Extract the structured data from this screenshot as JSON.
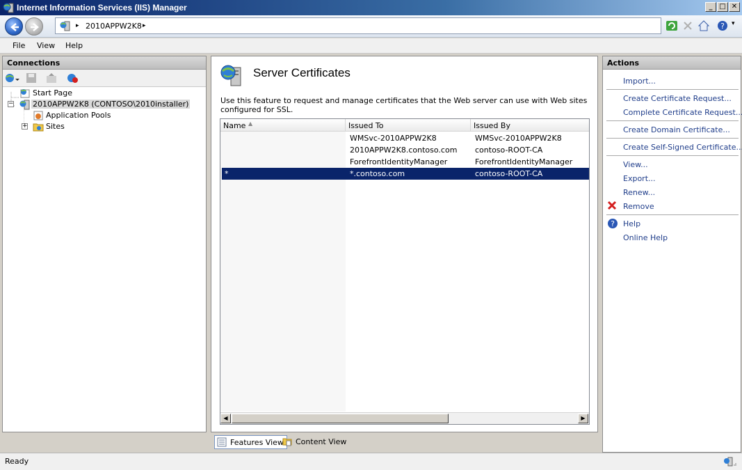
{
  "window": {
    "title": "Internet Information Services (IIS) Manager"
  },
  "address": {
    "crumb": "2010APPW2K8",
    "sep": "▸"
  },
  "menu": {
    "items": [
      "File",
      "View",
      "Help"
    ]
  },
  "connections": {
    "header": "Connections",
    "tree": {
      "start_page": "Start Page",
      "server": "2010APPW2K8 (CONTOSO\\2010installer)",
      "app_pools": "Application Pools",
      "sites": "Sites"
    }
  },
  "center": {
    "title": "Server Certificates",
    "description": "Use this feature to request and manage certificates that the Web server can use with Web sites configured for SSL.",
    "columns": {
      "name": "Name",
      "issued_to": "Issued To",
      "issued_by": "Issued By"
    },
    "rows": [
      {
        "name": "",
        "issued_to": "WMSvc-2010APPW2K8",
        "issued_by": "WMSvc-2010APPW2K8"
      },
      {
        "name": "",
        "issued_to": "2010APPW2K8.contoso.com",
        "issued_by": "contoso-ROOT-CA"
      },
      {
        "name": "",
        "issued_to": "ForefrontIdentityManager",
        "issued_by": "ForefrontIdentityManager"
      },
      {
        "name": "*",
        "issued_to": "*.contoso.com",
        "issued_by": "contoso-ROOT-CA"
      }
    ],
    "selected_row": 3,
    "views": {
      "features": "Features View",
      "content": "Content View"
    }
  },
  "actions": {
    "header": "Actions",
    "import": "Import...",
    "create_request": "Create Certificate Request...",
    "complete_request": "Complete Certificate Request...",
    "create_domain": "Create Domain Certificate...",
    "create_self_signed": "Create Self-Signed Certificate...",
    "view": "View...",
    "export": "Export...",
    "renew": "Renew...",
    "remove": "Remove",
    "help": "Help",
    "online_help": "Online Help"
  },
  "status": {
    "text": "Ready"
  },
  "icons": {
    "app": "iis-globe-server-icon",
    "back": "back-arrow-icon",
    "forward": "forward-arrow-icon",
    "server": "server-icon",
    "remove": "red-x-icon",
    "help": "help-icon"
  },
  "colors": {
    "selection": "#0a246a",
    "link": "#1f3d8a",
    "remove": "#d41f1f",
    "help": "#2a57b5"
  }
}
